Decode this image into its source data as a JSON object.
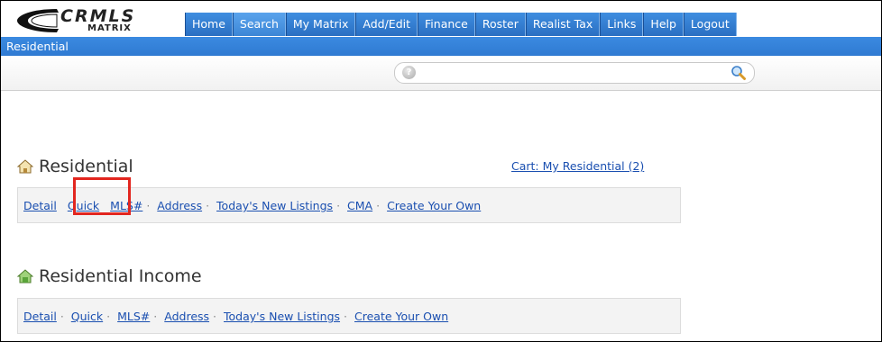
{
  "logo": {
    "brand": "CRMLS",
    "sub": "MATRIX"
  },
  "nav": {
    "tabs": [
      {
        "label": "Home"
      },
      {
        "label": "Search"
      },
      {
        "label": "My Matrix"
      },
      {
        "label": "Add/Edit"
      },
      {
        "label": "Finance"
      },
      {
        "label": "Roster"
      },
      {
        "label": "Realist Tax"
      },
      {
        "label": "Links"
      },
      {
        "label": "Help"
      },
      {
        "label": "Logout"
      }
    ],
    "active_tab": "Search"
  },
  "subbar": {
    "title": "Residential"
  },
  "search": {
    "value": "",
    "help_icon": "?"
  },
  "residential": {
    "title": "Residential",
    "cart_link": "Cart: My Residential (2)",
    "links": [
      "Detail",
      "Quick",
      "MLS#",
      "Address",
      "Today's New Listings",
      "CMA",
      "Create Your Own"
    ]
  },
  "income": {
    "title": "Residential Income",
    "links": [
      "Detail",
      "Quick",
      "MLS#",
      "Address",
      "Today's New Listings",
      "Create Your Own"
    ]
  },
  "colors": {
    "nav_blue": "#2f7ad2",
    "link_blue": "#1a4fb0",
    "highlight_red": "#e2261f"
  },
  "icons": {
    "help": "help-icon",
    "search": "magnifier-icon",
    "residential": "house-icon",
    "income": "house-money-icon"
  }
}
